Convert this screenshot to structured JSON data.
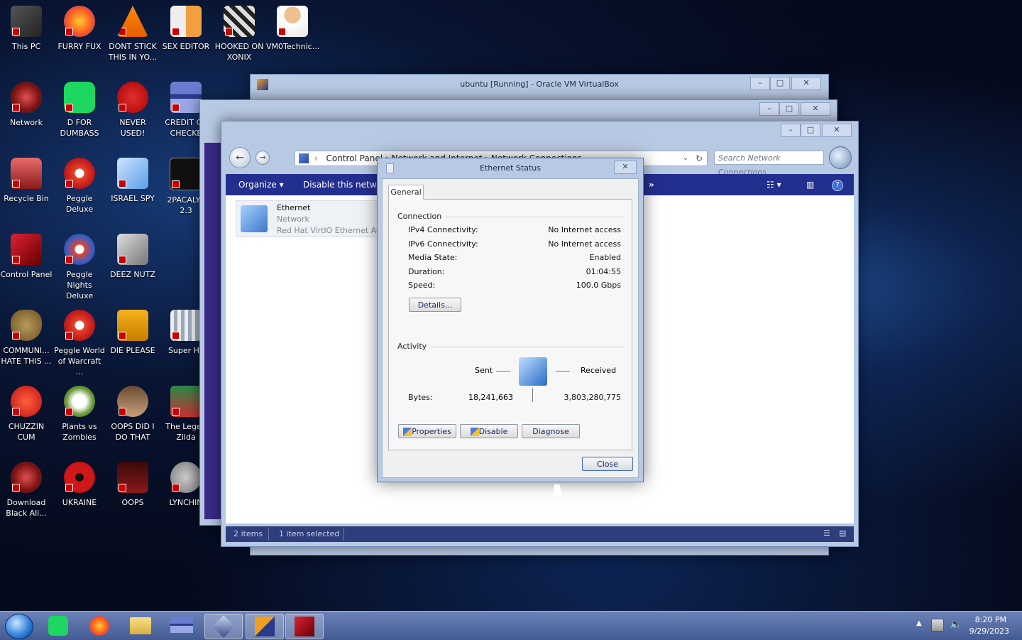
{
  "desktop_icons": [
    {
      "label": "This PC"
    },
    {
      "label": "FURRY FUX"
    },
    {
      "label": "DONT STICK THIS IN YO..."
    },
    {
      "label": "SEX EDITOR"
    },
    {
      "label": "HOOKED ON XONIX"
    },
    {
      "label": "VM0Technic..."
    },
    {
      "label": "Network"
    },
    {
      "label": "D FOR DUMBASS"
    },
    {
      "label": "NEVER USED!"
    },
    {
      "label": "CREDIT CA CHECKE"
    },
    {
      "label": "Recycle Bin"
    },
    {
      "label": "Peggle Deluxe"
    },
    {
      "label": "ISRAEL SPY"
    },
    {
      "label": "2PACALYF 2.3"
    },
    {
      "label": "Control Panel"
    },
    {
      "label": "Peggle Nights Deluxe"
    },
    {
      "label": "DEEZ NUTZ"
    },
    {
      "label": "COMMUNI... HATE THIS ..."
    },
    {
      "label": "Peggle World of Warcraft ..."
    },
    {
      "label": "DIE PLEASE"
    },
    {
      "label": "Super Hil"
    },
    {
      "label": "CHUZZIN CUM"
    },
    {
      "label": "Plants vs Zombies"
    },
    {
      "label": "OOPS DID I DO THAT"
    },
    {
      "label": "The Legen Zilda"
    },
    {
      "label": "Download Black Ali..."
    },
    {
      "label": "UKRAINE"
    },
    {
      "label": "OOPS"
    },
    {
      "label": "LYNCHIN"
    }
  ],
  "vbox_window": {
    "title": "ubuntu [Running] - Oracle VM VirtualBox"
  },
  "explorer": {
    "address": "Control Panel › Network and Internet › Network Connections",
    "search_placeholder": "Search Network Connections",
    "organize": "Organize",
    "disable": "Disable this network device",
    "item_name": "Ethernet",
    "item_status": "Network",
    "item_adapter": "Red Hat VirtIO Ethernet Adapter",
    "status_items": "2 items",
    "status_selected": "1 item selected"
  },
  "dialog": {
    "title": "Ethernet Status",
    "tab": "General",
    "connection_header": "Connection",
    "rows": [
      {
        "label": "IPv4 Connectivity:",
        "value": "No Internet access"
      },
      {
        "label": "IPv6 Connectivity:",
        "value": "No Internet access"
      },
      {
        "label": "Media State:",
        "value": "Enabled"
      },
      {
        "label": "Duration:",
        "value": "01:04:55"
      },
      {
        "label": "Speed:",
        "value": "100.0 Gbps"
      }
    ],
    "details_button": "Details...",
    "activity_header": "Activity",
    "sent_label": "Sent",
    "received_label": "Received",
    "bytes_label": "Bytes:",
    "bytes_sent": "18,241,663",
    "bytes_received": "3,803,280,775",
    "properties_button": "Properties",
    "disable_button": "Disable",
    "diagnose_button": "Diagnose",
    "close_button": "Close"
  },
  "taskbar": {
    "time": "8:20 PM",
    "date": "9/29/2023"
  },
  "colors": {
    "command_bar": "#232f8f",
    "window_frame": "#b8c9e3",
    "taskbar": "#435a93"
  }
}
